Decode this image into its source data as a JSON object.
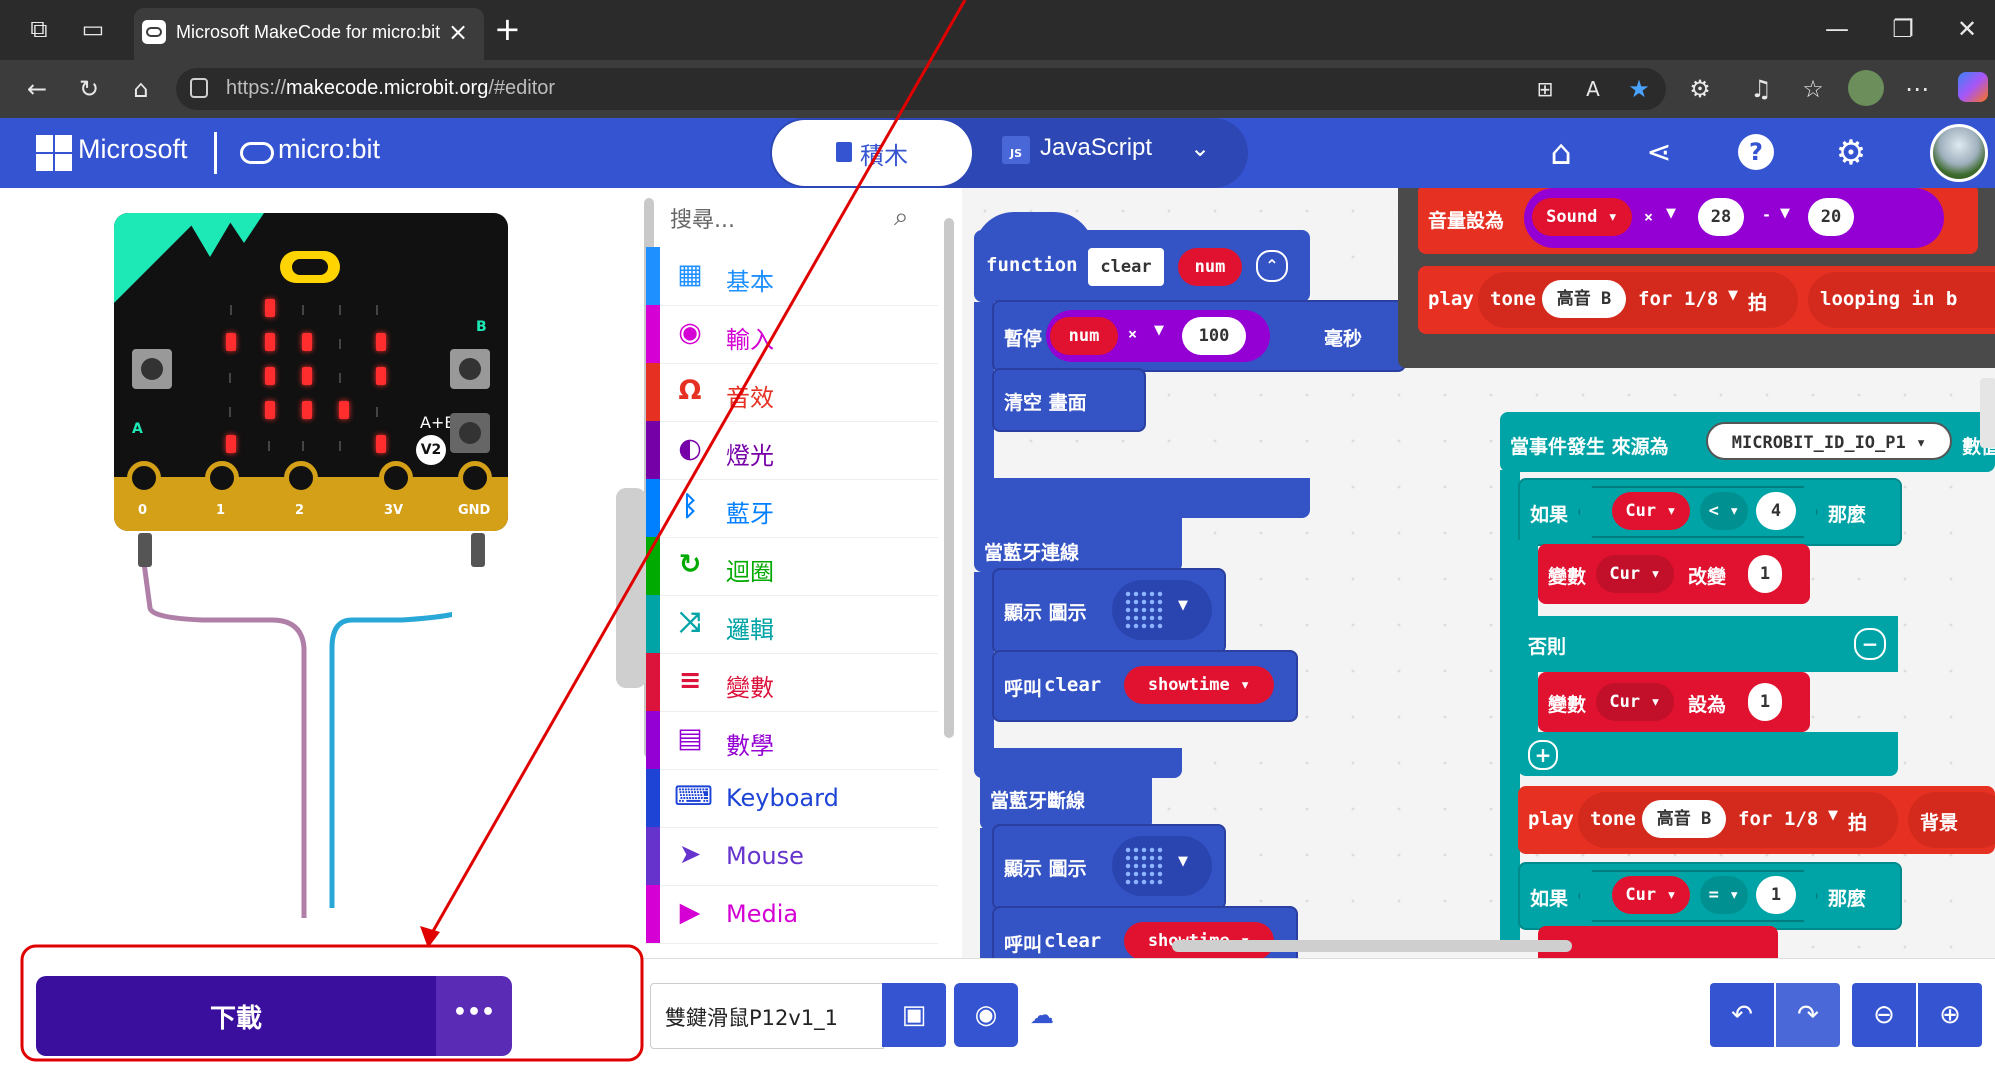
{
  "browser": {
    "tab_title": "Microsoft MakeCode for micro:bit",
    "tab_close": "×",
    "new_tab": "+",
    "url_prefix": "https://",
    "url_host": "makecode.microbit.org",
    "url_path": "/#editor"
  },
  "header": {
    "ms_brand": "Microsoft",
    "mb_brand": "micro:bit",
    "blocks_label": "積木",
    "js_label": "JavaScript",
    "js_badge": "JS"
  },
  "simulator": {
    "pins": [
      "0",
      "1",
      "2",
      "3V",
      "GND"
    ],
    "btn_a": "A",
    "btn_b": "B",
    "btn_ab": "A+B",
    "version": "V2"
  },
  "toolbox": {
    "search_placeholder": "搜尋...",
    "categories": [
      {
        "label": "基本",
        "color": "#1e90ff",
        "icon": "grid-icon"
      },
      {
        "label": "輸入",
        "color": "#d400d4",
        "icon": "circle-icon"
      },
      {
        "label": "音效",
        "color": "#e63022",
        "icon": "headphones-icon"
      },
      {
        "label": "燈光",
        "color": "#7600a8",
        "icon": "toggle-icon"
      },
      {
        "label": "藍牙",
        "color": "#007fff",
        "icon": "bluetooth-icon"
      },
      {
        "label": "迴圈",
        "color": "#00aa00",
        "icon": "loop-icon"
      },
      {
        "label": "邏輯",
        "color": "#00a4a6",
        "icon": "shuffle-icon"
      },
      {
        "label": "變數",
        "color": "#dc143c",
        "icon": "list-icon"
      },
      {
        "label": "數學",
        "color": "#9400d3",
        "icon": "calculator-icon"
      },
      {
        "label": "Keyboard",
        "color": "#1e44d6",
        "icon": "keyboard-icon"
      },
      {
        "label": "Mouse",
        "color": "#6633cc",
        "icon": "pointer-icon"
      },
      {
        "label": "Media",
        "color": "#d400d4",
        "icon": "play-icon"
      }
    ]
  },
  "workspace": {
    "func_kw": "function",
    "func_name": "clear",
    "func_param": "num",
    "pause_kw": "暫停",
    "pause_var": "num",
    "times": "×",
    "pause_val": "100",
    "ms_unit": "毫秒",
    "clear_screen": "清空 畫面",
    "bt_connect": "當藍牙連線",
    "show_icon": "顯示 圖示",
    "call_kw": "呼叫",
    "call_name": "clear",
    "call_arg": "showtime",
    "bt_disconnect": "當藍牙斷線",
    "volume_set": "音量設為",
    "sound_var": "Sound",
    "vol_val": "28",
    "minus": "-",
    "vol_minus": "20",
    "play_kw": "play",
    "tone_kw": "tone",
    "tone_note": "高音 B",
    "for_kw": "for",
    "beat_frac": "1/8",
    "beat_unit": "拍",
    "looping": "looping in b",
    "event_kw": "當事件發生 來源為",
    "event_src": "MICROBIT_ID_IO_P1",
    "event_tail": "數值",
    "if_kw": "如果",
    "cur_var": "Cur",
    "lt": "<",
    "lt_val": "4",
    "then_kw": "那麼",
    "var_kw": "變數",
    "change_kw": "改變",
    "change_val": "1",
    "else_kw": "否則",
    "set_kw": "設為",
    "set_val": "1",
    "bg_kw": "背景",
    "eq": "=",
    "eq_val": "1"
  },
  "bottom": {
    "download_label": "下載",
    "more_label": "•••",
    "project_name": "雙鍵滑鼠P12v1_1"
  },
  "annotation": {
    "color": "#e00000"
  }
}
